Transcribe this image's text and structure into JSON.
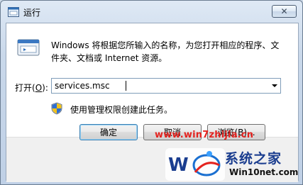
{
  "window": {
    "title": "运行",
    "close_glyph": "✕"
  },
  "dialog": {
    "description": "Windows 将根据您所输入的名称，为您打开相应的程序、文件夹、文档或 Internet 资源。",
    "open_label_prefix": "打开(",
    "open_label_key": "O",
    "open_label_suffix": "):",
    "input_value": "services.msc",
    "admin_note": "使用管理权限创建此任务。",
    "buttons": {
      "ok": "确定",
      "cancel": "取消",
      "browse": "浏览(B)..."
    }
  },
  "watermark": {
    "url": "www.win7zhijia.cn",
    "logo_text": "系统之家",
    "logo_url": "Win10net.com"
  },
  "colors": {
    "accent": "#1a3d8f",
    "watermark_red": "#e4231f"
  }
}
